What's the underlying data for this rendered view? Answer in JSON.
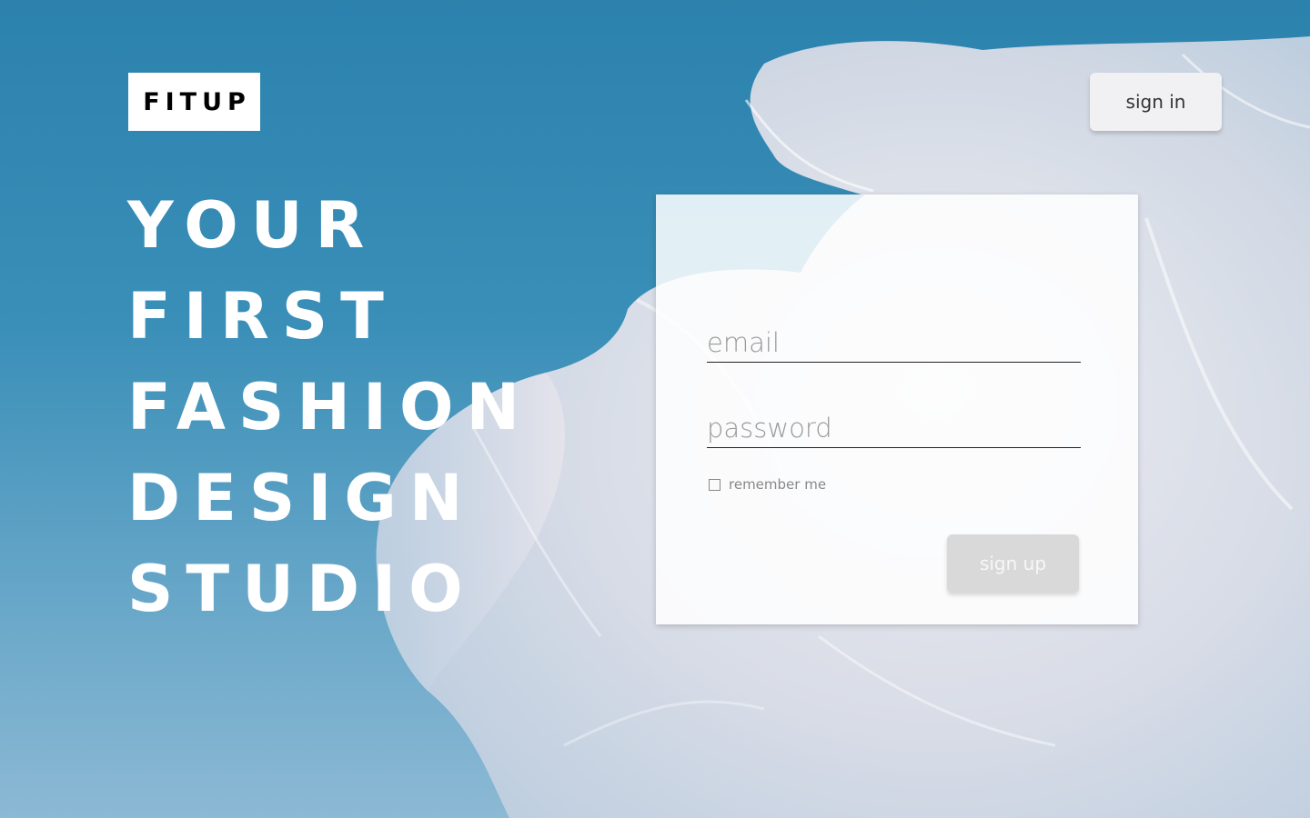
{
  "brand": {
    "logo_text": "FITUP"
  },
  "header": {
    "signin_label": "sign in"
  },
  "headline": {
    "lines": [
      "YOUR",
      "FIRST",
      "FASHION",
      "DESIGN",
      "STUDIO"
    ]
  },
  "form": {
    "email_placeholder": "email",
    "email_value": "",
    "password_placeholder": "password",
    "password_value": "",
    "remember_label": "remember me",
    "remember_checked": false,
    "signup_label": "sign up"
  },
  "colors": {
    "sky": "#2b82ad",
    "logo_bg": "#ffffff",
    "headline_text": "#ffffff",
    "button_bg": "#f1f0f2",
    "signup_bg": "#d9d9da"
  }
}
